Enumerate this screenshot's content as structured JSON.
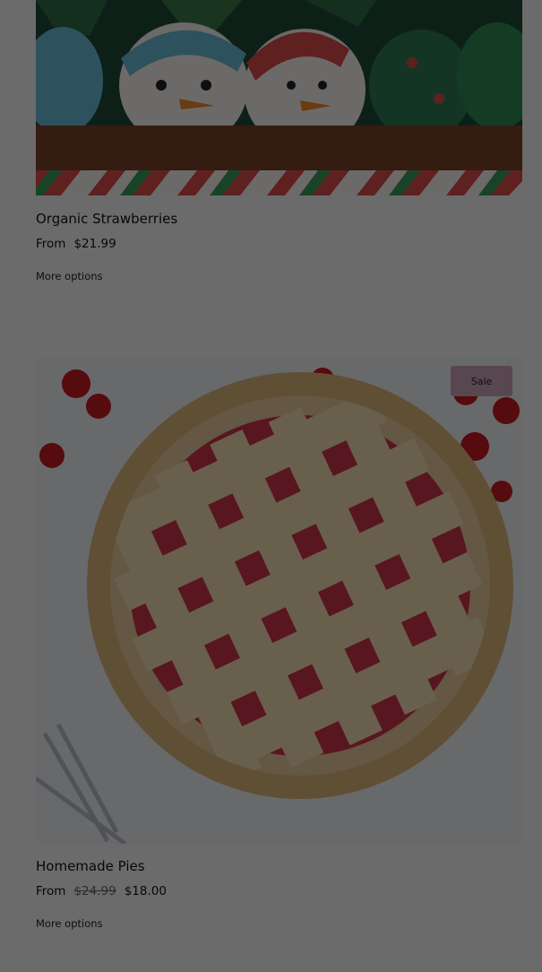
{
  "products": [
    {
      "title": "Organic Strawberries",
      "from_label": "From",
      "price": "$21.99",
      "more_options": "More options",
      "image_icon": "chocolate-strawberries-image"
    },
    {
      "title": "Homemade Pies",
      "from_label": "From",
      "compare_price": "$24.99",
      "price": "$18.00",
      "more_options": "More options",
      "badge": "Sale",
      "image_icon": "cherry-pie-image"
    }
  ],
  "colors": {
    "overlay": "rgba(0,0,0,0.56)",
    "sale_badge": "#c9a3b4",
    "background": "#f4f4f4"
  }
}
